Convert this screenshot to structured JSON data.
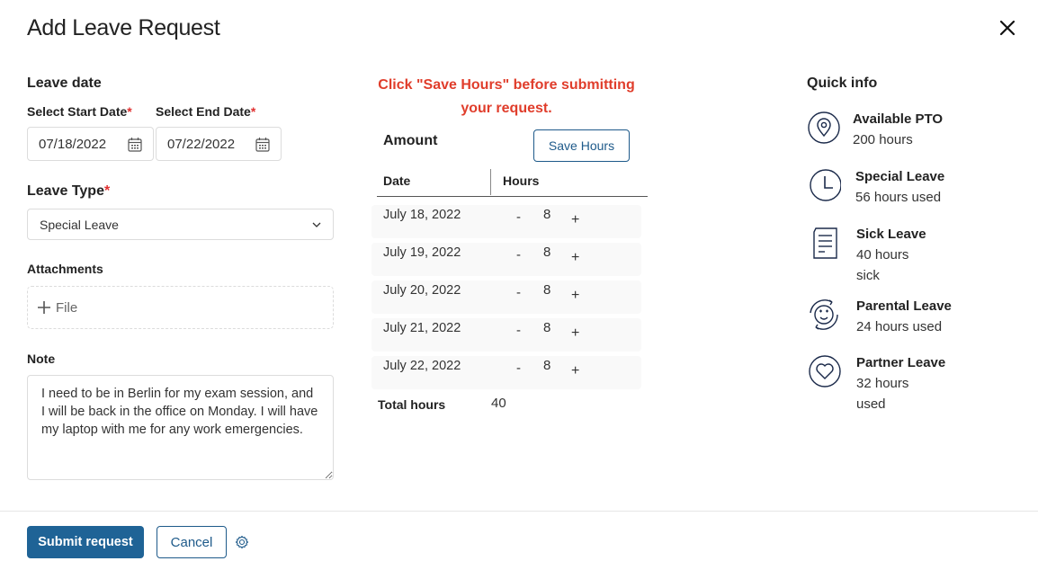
{
  "dialog": {
    "title": "Add Leave Request",
    "close_icon": "close-icon"
  },
  "left": {
    "leave_date_heading": "Leave date",
    "start_date_label": "Select Start Date",
    "end_date_label": "Select End Date",
    "required_mark": "*",
    "start_date_value": "07/18/2022",
    "end_date_value": "07/22/2022",
    "leave_type_label": "Leave Type",
    "leave_type_value": "Special Leave",
    "attachments_label": "Attachments",
    "file_button_label": "File",
    "note_label": "Note",
    "note_value": "I need to be in Berlin for my exam session, and I will be back in the office on Monday. I will have my laptop with me for any work emergencies."
  },
  "middle": {
    "warning": "Click \"Save Hours\" before submitting your request.",
    "amount_heading": "Amount",
    "save_hours_label": "Save Hours",
    "columns": [
      "Date",
      "Hours"
    ],
    "rows": [
      {
        "date": "July 18, 2022",
        "hours": "8"
      },
      {
        "date": "July 19, 2022",
        "hours": "8"
      },
      {
        "date": "July 20, 2022",
        "hours": "8"
      },
      {
        "date": "July 21, 2022",
        "hours": "8"
      },
      {
        "date": "July 22, 2022",
        "hours": "8"
      }
    ],
    "decrement_label": "-",
    "increment_label": "+",
    "total_label": "Total hours",
    "total_value": "40"
  },
  "quick_info": {
    "heading": "Quick info",
    "items": [
      {
        "icon": "location-pin-icon",
        "title": "Available PTO",
        "sub": "200 hours"
      },
      {
        "icon": "clock-icon",
        "title": "Special Leave",
        "sub": "56 hours used"
      },
      {
        "icon": "document-icon",
        "title": "Sick Leave",
        "sub": "40 hours sick"
      },
      {
        "icon": "baby-face-icon",
        "title": "Parental Leave",
        "sub": "24 hours used"
      },
      {
        "icon": "heart-icon",
        "title": "Partner Leave",
        "sub": "32 hours used"
      }
    ]
  },
  "footer": {
    "submit_label": "Submit request",
    "cancel_label": "Cancel",
    "settings_icon": "gear-icon"
  },
  "colors": {
    "primary": "#1f6396",
    "warning": "#e03d2b",
    "required": "#e03131",
    "icon_navy": "#1b2a4a"
  }
}
